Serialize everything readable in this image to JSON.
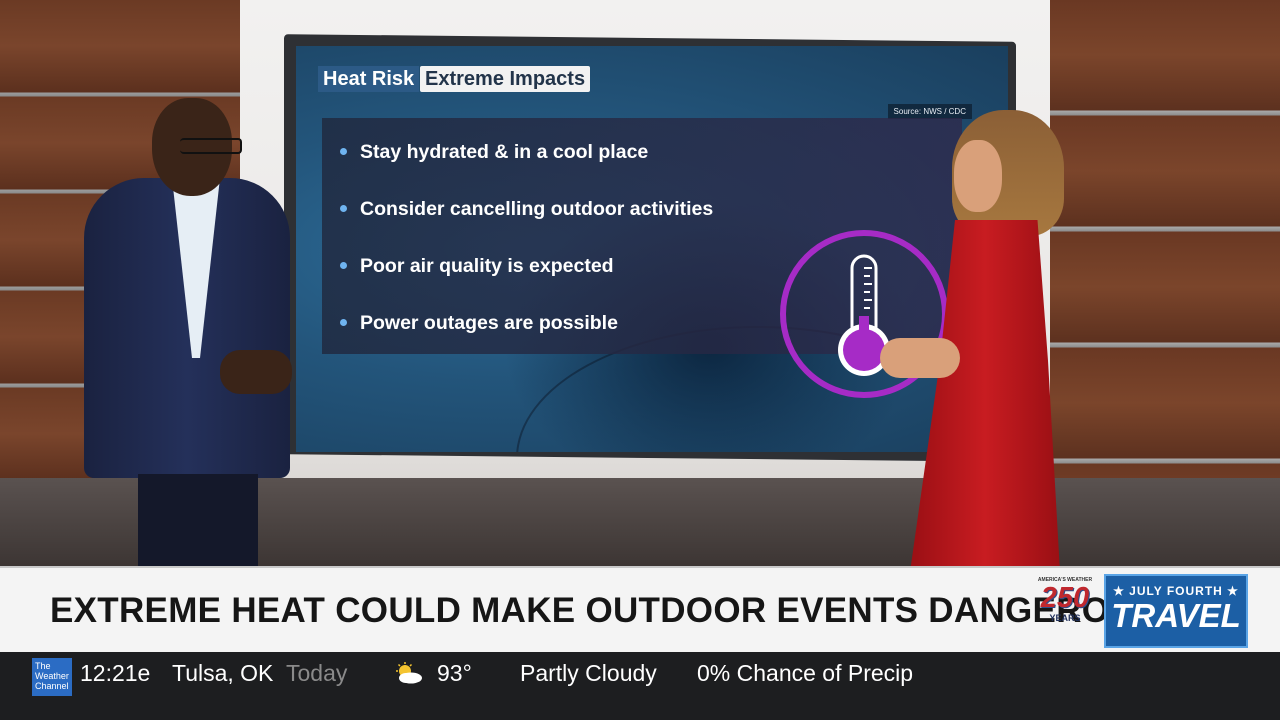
{
  "screen": {
    "tag_primary": "Heat Risk",
    "tag_secondary": "Extreme Impacts",
    "source": "Source: NWS / CDC",
    "bullets": [
      "Stay hydrated & in a cool place",
      "Consider cancelling outdoor activities",
      "Poor air quality is expected",
      "Power outages are possible"
    ],
    "icon": "thermometer-icon"
  },
  "lower_third": {
    "headline": "EXTREME HEAT COULD MAKE OUTDOOR EVENTS DANGEROUS",
    "badge_top": "AMERICA'S WEATHER",
    "badge_number": "250",
    "badge_bottom": "YEARS",
    "travel_top": "★ JULY FOURTH ★",
    "travel_main": "TRAVEL"
  },
  "ticker": {
    "logo": "The Weather Channel",
    "time": "12:21e",
    "location": "Tulsa, OK",
    "day": "Today",
    "icon": "partly-cloudy-icon",
    "temperature": "93°",
    "condition": "Partly Cloudy",
    "precip": "0% Chance of Precip"
  },
  "colors": {
    "ring": "#a62bc6",
    "bullet": "#6fb4f0",
    "dress": "#c81c21",
    "logo": "#2b6cc4",
    "travel": "#1c5fa5"
  }
}
